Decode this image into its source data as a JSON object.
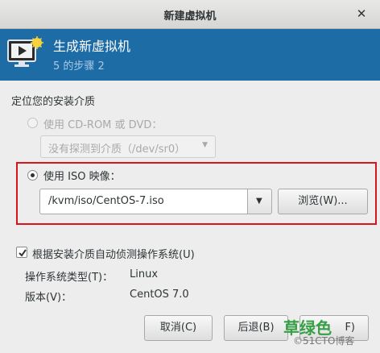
{
  "window": {
    "title": "新建虚拟机",
    "close_glyph": "✕"
  },
  "banner": {
    "title": "生成新虚拟机",
    "step": "5 的步骤 2",
    "icon": "vm-monitor-icon"
  },
  "install_media": {
    "section_label": "定位您的安装介质",
    "cdrom_option": {
      "label": "使用  CD-ROM 或 DVD：",
      "selected": false,
      "disabled": true,
      "combo_value": "没有探测到介质（/dev/sr0）"
    },
    "iso_option": {
      "label": "使用  ISO 映像：",
      "selected": true,
      "path": "/kvm/iso/CentOS-7.iso",
      "browse_label": "浏览(W)..."
    }
  },
  "os_detect": {
    "checkbox_label": "根据安装介质自动侦测操作系统(U)",
    "checked": true,
    "os_type_label": "操作系统类型(T)：",
    "os_type_value": "Linux",
    "version_label": "版本(V)：",
    "version_value": "CentOS 7.0"
  },
  "buttons": {
    "cancel": "取消(C)",
    "back": "后退(B)",
    "forward": "F)"
  },
  "watermark": {
    "text": "草绿色",
    "sub": "©51CTO博客"
  },
  "colors": {
    "banner_bg": "#1d6ca6",
    "highlight_border": "#d9141b",
    "watermark": "#35a046"
  }
}
